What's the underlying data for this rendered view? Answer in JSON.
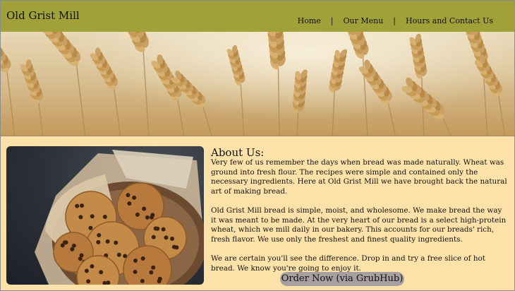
{
  "header": {
    "brand": "Old Grist Mill",
    "nav": [
      {
        "label": "Home"
      },
      {
        "label": "Our Menu"
      },
      {
        "label": "Hours and Contact Us"
      }
    ],
    "separator": "|",
    "background_color": "#a1a13a"
  },
  "hero": {
    "image": "wheat-field"
  },
  "about": {
    "image": "cookies-basket",
    "title": "About Us:",
    "paragraphs": [
      "Very few of us remember the days when bread was made naturally. Wheat was ground into fresh flour. The recipes were simple and contained only the necessary ingredients. Here at Old Grist Mill we have brought back the natural art of making bread.",
      "Old Grist Mill bread is simple, moist, and wholesome. We make bread the way it was meant to be made. At the very heart of our bread is a select high-protein wheat, which we mill daily in our bakery. This accounts for our breads' rich, fresh flavor. We use only the freshest and finest quality ingredients.",
      "We are certain you'll see the difference. Drop in and try a free slice of hot bread. We know you're going to enjoy it."
    ]
  },
  "cta": {
    "order_label": "Order Now (via GrubHub)"
  },
  "colors": {
    "page_background": "#fce2a8",
    "button": "#a8a0a0"
  }
}
